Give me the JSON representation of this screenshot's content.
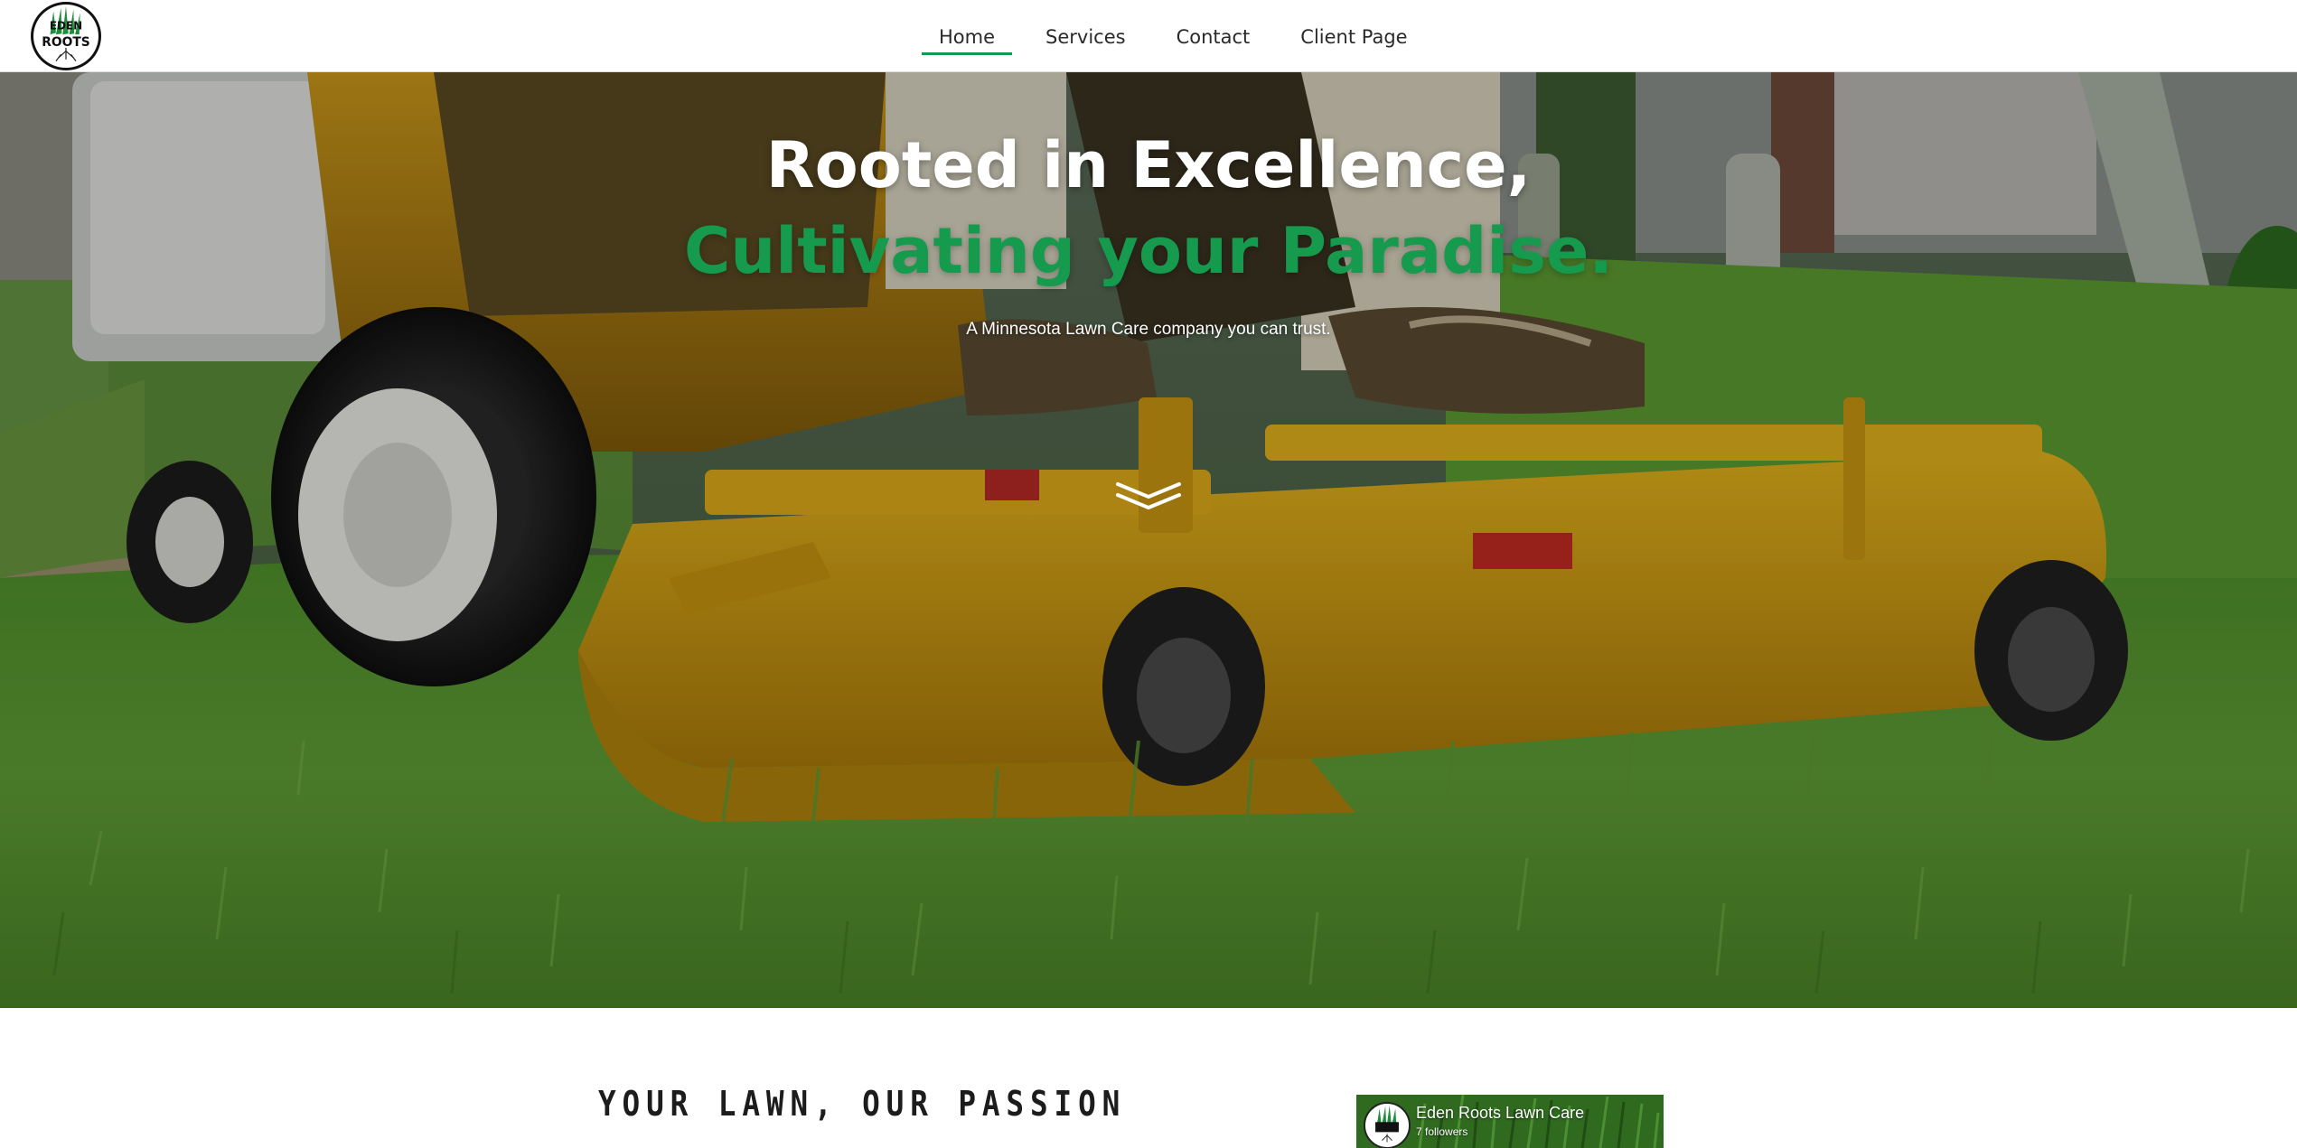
{
  "brand": {
    "logo_icon": "eden-roots-logo",
    "logo_text_top": "EDEN",
    "logo_text_bottom": "ROOTS"
  },
  "nav": {
    "items": [
      {
        "label": "Home",
        "active": true
      },
      {
        "label": "Services",
        "active": false
      },
      {
        "label": "Contact",
        "active": false
      },
      {
        "label": "Client Page",
        "active": false
      }
    ]
  },
  "hero": {
    "title_line1": "Rooted in Excellence,",
    "title_line2": "Cultivating your Paradise.",
    "subtitle": "A Minnesota Lawn Care company you can trust.",
    "scroll_icon": "double-chevron-down-icon"
  },
  "section": {
    "heading": "YOUR LAWN, OUR PASSION"
  },
  "facebook": {
    "page_name": "Eden Roots Lawn Care",
    "followers": "7 followers"
  },
  "colors": {
    "accent": "#169a4e",
    "nav_underline": "#159a4c",
    "mower_yellow": "#d8a514",
    "grass": "#4f8a2c"
  }
}
